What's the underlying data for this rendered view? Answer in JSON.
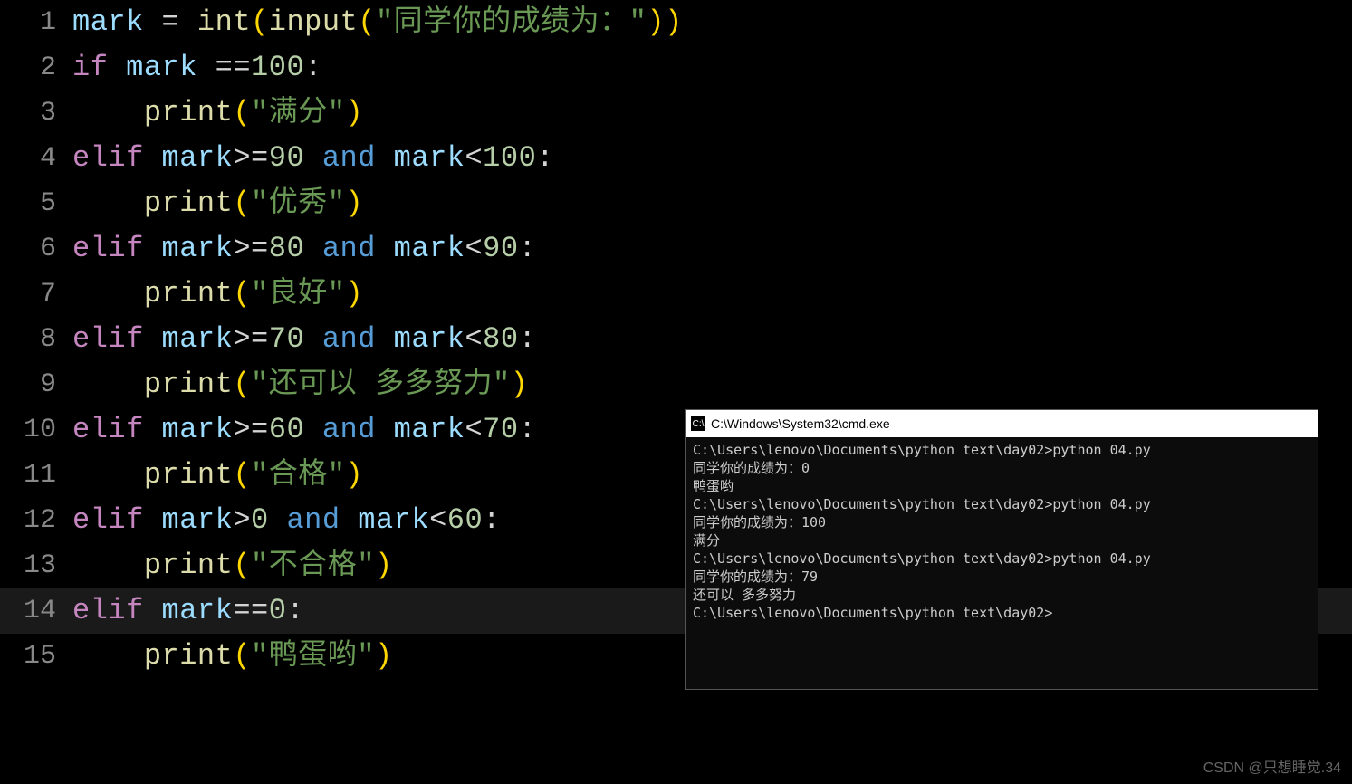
{
  "editor": {
    "active_line": 14,
    "lines": [
      {
        "no": 1,
        "tokens": [
          {
            "c": "t-var",
            "t": "mark"
          },
          {
            "c": "t-white",
            "t": " "
          },
          {
            "c": "t-op",
            "t": "="
          },
          {
            "c": "t-white",
            "t": " "
          },
          {
            "c": "t-func",
            "t": "int"
          },
          {
            "c": "t-paren",
            "t": "("
          },
          {
            "c": "t-func",
            "t": "input"
          },
          {
            "c": "t-paren",
            "t": "("
          },
          {
            "c": "t-str",
            "t": "\"同学你的成绩为：\""
          },
          {
            "c": "t-paren",
            "t": ")"
          },
          {
            "c": "t-paren",
            "t": ")"
          }
        ]
      },
      {
        "no": 2,
        "tokens": [
          {
            "c": "t-kw",
            "t": "if"
          },
          {
            "c": "t-white",
            "t": " "
          },
          {
            "c": "t-var",
            "t": "mark"
          },
          {
            "c": "t-white",
            "t": " "
          },
          {
            "c": "t-op",
            "t": "=="
          },
          {
            "c": "t-num",
            "t": "100"
          },
          {
            "c": "t-white",
            "t": ":"
          }
        ]
      },
      {
        "no": 3,
        "tokens": [
          {
            "c": "t-white",
            "t": "    "
          },
          {
            "c": "t-func",
            "t": "print"
          },
          {
            "c": "t-paren",
            "t": "("
          },
          {
            "c": "t-str",
            "t": "\"满分\""
          },
          {
            "c": "t-paren",
            "t": ")"
          }
        ]
      },
      {
        "no": 4,
        "tokens": [
          {
            "c": "t-kw",
            "t": "elif"
          },
          {
            "c": "t-white",
            "t": " "
          },
          {
            "c": "t-var",
            "t": "mark"
          },
          {
            "c": "t-op",
            "t": ">="
          },
          {
            "c": "t-num",
            "t": "90"
          },
          {
            "c": "t-white",
            "t": " "
          },
          {
            "c": "t-logical",
            "t": "and"
          },
          {
            "c": "t-white",
            "t": " "
          },
          {
            "c": "t-var",
            "t": "mark"
          },
          {
            "c": "t-op",
            "t": "<"
          },
          {
            "c": "t-num",
            "t": "100"
          },
          {
            "c": "t-white",
            "t": ":"
          }
        ]
      },
      {
        "no": 5,
        "tokens": [
          {
            "c": "t-white",
            "t": "    "
          },
          {
            "c": "t-func",
            "t": "print"
          },
          {
            "c": "t-paren",
            "t": "("
          },
          {
            "c": "t-str",
            "t": "\"优秀\""
          },
          {
            "c": "t-paren",
            "t": ")"
          }
        ]
      },
      {
        "no": 6,
        "tokens": [
          {
            "c": "t-kw",
            "t": "elif"
          },
          {
            "c": "t-white",
            "t": " "
          },
          {
            "c": "t-var",
            "t": "mark"
          },
          {
            "c": "t-op",
            "t": ">="
          },
          {
            "c": "t-num",
            "t": "80"
          },
          {
            "c": "t-white",
            "t": " "
          },
          {
            "c": "t-logical",
            "t": "and"
          },
          {
            "c": "t-white",
            "t": " "
          },
          {
            "c": "t-var",
            "t": "mark"
          },
          {
            "c": "t-op",
            "t": "<"
          },
          {
            "c": "t-num",
            "t": "90"
          },
          {
            "c": "t-white",
            "t": ":"
          }
        ]
      },
      {
        "no": 7,
        "tokens": [
          {
            "c": "t-white",
            "t": "    "
          },
          {
            "c": "t-func",
            "t": "print"
          },
          {
            "c": "t-paren",
            "t": "("
          },
          {
            "c": "t-str",
            "t": "\"良好\""
          },
          {
            "c": "t-paren",
            "t": ")"
          }
        ]
      },
      {
        "no": 8,
        "tokens": [
          {
            "c": "t-kw",
            "t": "elif"
          },
          {
            "c": "t-white",
            "t": " "
          },
          {
            "c": "t-var",
            "t": "mark"
          },
          {
            "c": "t-op",
            "t": ">="
          },
          {
            "c": "t-num",
            "t": "70"
          },
          {
            "c": "t-white",
            "t": " "
          },
          {
            "c": "t-logical",
            "t": "and"
          },
          {
            "c": "t-white",
            "t": " "
          },
          {
            "c": "t-var",
            "t": "mark"
          },
          {
            "c": "t-op",
            "t": "<"
          },
          {
            "c": "t-num",
            "t": "80"
          },
          {
            "c": "t-white",
            "t": ":"
          }
        ]
      },
      {
        "no": 9,
        "tokens": [
          {
            "c": "t-white",
            "t": "    "
          },
          {
            "c": "t-func",
            "t": "print"
          },
          {
            "c": "t-paren",
            "t": "("
          },
          {
            "c": "t-str",
            "t": "\"还可以 多多努力\""
          },
          {
            "c": "t-paren",
            "t": ")"
          }
        ]
      },
      {
        "no": 10,
        "tokens": [
          {
            "c": "t-kw",
            "t": "elif"
          },
          {
            "c": "t-white",
            "t": " "
          },
          {
            "c": "t-var",
            "t": "mark"
          },
          {
            "c": "t-op",
            "t": ">="
          },
          {
            "c": "t-num",
            "t": "60"
          },
          {
            "c": "t-white",
            "t": " "
          },
          {
            "c": "t-logical",
            "t": "and"
          },
          {
            "c": "t-white",
            "t": " "
          },
          {
            "c": "t-var",
            "t": "mark"
          },
          {
            "c": "t-op",
            "t": "<"
          },
          {
            "c": "t-num",
            "t": "70"
          },
          {
            "c": "t-white",
            "t": ":"
          }
        ]
      },
      {
        "no": 11,
        "tokens": [
          {
            "c": "t-white",
            "t": "    "
          },
          {
            "c": "t-func",
            "t": "print"
          },
          {
            "c": "t-paren",
            "t": "("
          },
          {
            "c": "t-str",
            "t": "\"合格\""
          },
          {
            "c": "t-paren",
            "t": ")"
          }
        ]
      },
      {
        "no": 12,
        "tokens": [
          {
            "c": "t-kw",
            "t": "elif"
          },
          {
            "c": "t-white",
            "t": " "
          },
          {
            "c": "t-var",
            "t": "mark"
          },
          {
            "c": "t-op",
            "t": ">"
          },
          {
            "c": "t-num",
            "t": "0"
          },
          {
            "c": "t-white",
            "t": " "
          },
          {
            "c": "t-logical",
            "t": "and"
          },
          {
            "c": "t-white",
            "t": " "
          },
          {
            "c": "t-var",
            "t": "mark"
          },
          {
            "c": "t-op",
            "t": "<"
          },
          {
            "c": "t-num",
            "t": "60"
          },
          {
            "c": "t-white",
            "t": ":"
          }
        ]
      },
      {
        "no": 13,
        "tokens": [
          {
            "c": "t-white",
            "t": "    "
          },
          {
            "c": "t-func",
            "t": "print"
          },
          {
            "c": "t-paren",
            "t": "("
          },
          {
            "c": "t-str",
            "t": "\"不合格\""
          },
          {
            "c": "t-paren",
            "t": ")"
          }
        ]
      },
      {
        "no": 14,
        "tokens": [
          {
            "c": "t-kw",
            "t": "elif"
          },
          {
            "c": "t-white",
            "t": " "
          },
          {
            "c": "t-var",
            "t": "mark"
          },
          {
            "c": "t-op",
            "t": "=="
          },
          {
            "c": "t-num",
            "t": "0"
          },
          {
            "c": "t-white",
            "t": ":"
          }
        ]
      },
      {
        "no": 15,
        "tokens": [
          {
            "c": "t-white",
            "t": "    "
          },
          {
            "c": "t-func",
            "t": "print"
          },
          {
            "c": "t-paren",
            "t": "("
          },
          {
            "c": "t-str",
            "t": "\"鸭蛋哟\""
          },
          {
            "c": "t-paren",
            "t": ")"
          }
        ]
      }
    ]
  },
  "cmd": {
    "title": "C:\\Windows\\System32\\cmd.exe",
    "icon_label": "C:\\",
    "lines": [
      "C:\\Users\\lenovo\\Documents\\python text\\day02>python 04.py",
      "同学你的成绩为：0",
      "鸭蛋哟",
      "",
      "C:\\Users\\lenovo\\Documents\\python text\\day02>python 04.py",
      "同学你的成绩为：100",
      "满分",
      "",
      "C:\\Users\\lenovo\\Documents\\python text\\day02>python 04.py",
      "同学你的成绩为：79",
      "还可以 多多努力",
      "",
      "C:\\Users\\lenovo\\Documents\\python text\\day02>"
    ]
  },
  "watermark": "CSDN @只想睡觉.34"
}
